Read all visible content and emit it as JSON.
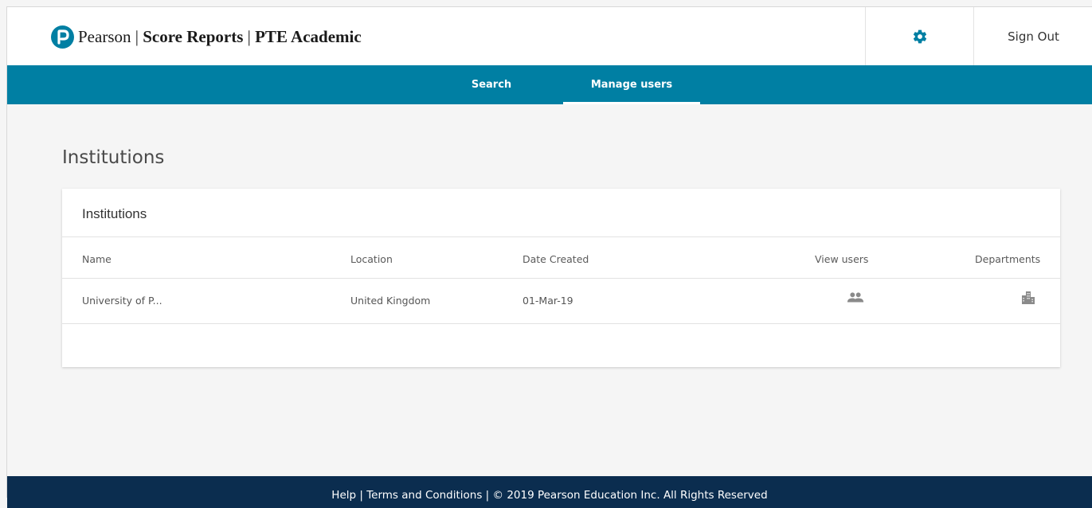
{
  "header": {
    "brand": "Pearson",
    "sep1": " | ",
    "product": "Score Reports",
    "sep2": " | ",
    "exam": "PTE Academic",
    "settings_icon": "gear-icon",
    "sign_out_label": "Sign Out"
  },
  "nav": {
    "tabs": [
      {
        "label": "Search",
        "active": false
      },
      {
        "label": "Manage users",
        "active": true
      }
    ]
  },
  "main": {
    "page_title": "Institutions",
    "card_title": "Institutions",
    "table": {
      "columns": [
        "Name",
        "Location",
        "Date Created",
        "View users",
        "Departments"
      ],
      "rows": [
        {
          "name": "University of P...",
          "location": "United Kingdom",
          "date_created": "01-Mar-19",
          "view_users_icon": "users-icon",
          "departments_icon": "building-icon"
        }
      ]
    }
  },
  "footer": {
    "text": "Help | Terms and Conditions | © 2019 Pearson Education Inc. All Rights Reserved"
  },
  "colors": {
    "brand": "#007fa3",
    "footer": "#0b2d4f",
    "background": "#f5f5f5"
  }
}
